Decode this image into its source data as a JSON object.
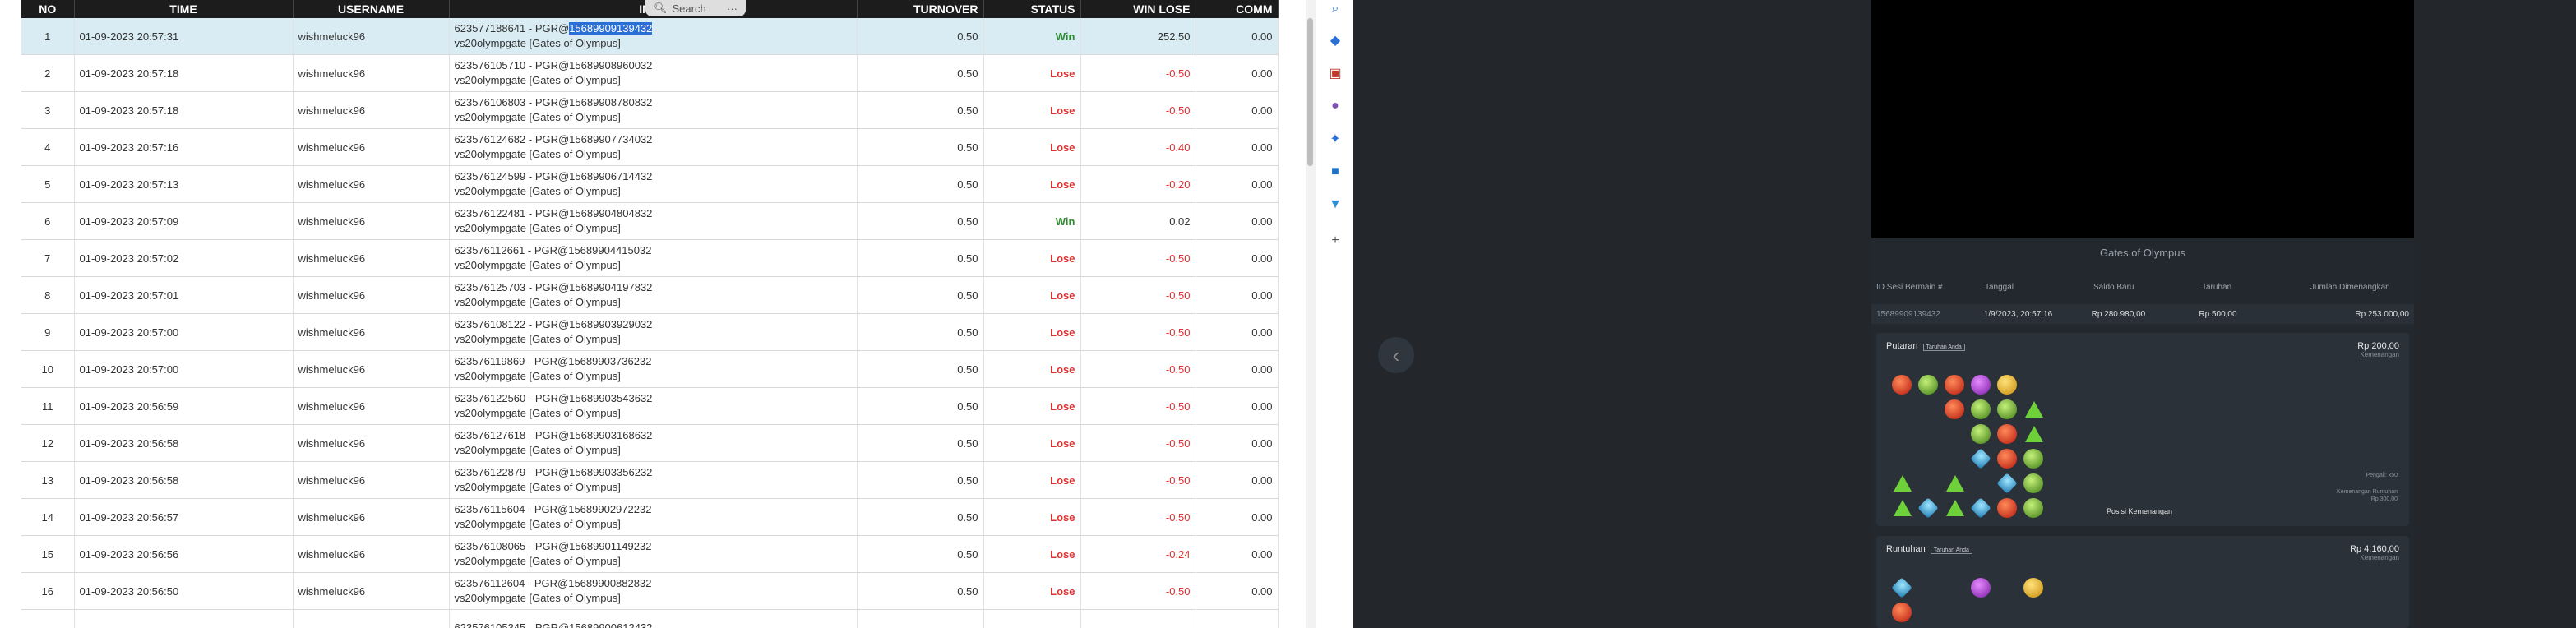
{
  "search": {
    "label": "Search",
    "menu": "···"
  },
  "table": {
    "headers": [
      "NO",
      "TIME",
      "USERNAME",
      "INFO",
      "TURNOVER",
      "STATUS",
      "WIN LOSE",
      "COMM"
    ],
    "rows": [
      {
        "no": "1",
        "time": "01-09-2023 20:57:31",
        "user": "wishmeluck96",
        "info_a": "623577188641 - PGR@",
        "info_hl": "15689909139432",
        "info_b": "vs20olympgate [Gates of Olympus]",
        "turnover": "0.50",
        "status": "Win",
        "winlose": "252.50",
        "comm": "0.00"
      },
      {
        "no": "2",
        "time": "01-09-2023 20:57:18",
        "user": "wishmeluck96",
        "info_a": "623576105710 - PGR@15689908960032",
        "info_hl": "",
        "info_b": "vs20olympgate [Gates of Olympus]",
        "turnover": "0.50",
        "status": "Lose",
        "winlose": "-0.50",
        "comm": "0.00"
      },
      {
        "no": "3",
        "time": "01-09-2023 20:57:18",
        "user": "wishmeluck96",
        "info_a": "623576106803 - PGR@15689908780832",
        "info_hl": "",
        "info_b": "vs20olympgate [Gates of Olympus]",
        "turnover": "0.50",
        "status": "Lose",
        "winlose": "-0.50",
        "comm": "0.00"
      },
      {
        "no": "4",
        "time": "01-09-2023 20:57:16",
        "user": "wishmeluck96",
        "info_a": "623576124682 - PGR@15689907734032",
        "info_hl": "",
        "info_b": "vs20olympgate [Gates of Olympus]",
        "turnover": "0.50",
        "status": "Lose",
        "winlose": "-0.40",
        "comm": "0.00"
      },
      {
        "no": "5",
        "time": "01-09-2023 20:57:13",
        "user": "wishmeluck96",
        "info_a": "623576124599 - PGR@15689906714432",
        "info_hl": "",
        "info_b": "vs20olympgate [Gates of Olympus]",
        "turnover": "0.50",
        "status": "Lose",
        "winlose": "-0.20",
        "comm": "0.00"
      },
      {
        "no": "6",
        "time": "01-09-2023 20:57:09",
        "user": "wishmeluck96",
        "info_a": "623576122481 - PGR@15689904804832",
        "info_hl": "",
        "info_b": "vs20olympgate [Gates of Olympus]",
        "turnover": "0.50",
        "status": "Win",
        "winlose": "0.02",
        "comm": "0.00"
      },
      {
        "no": "7",
        "time": "01-09-2023 20:57:02",
        "user": "wishmeluck96",
        "info_a": "623576112661 - PGR@15689904415032",
        "info_hl": "",
        "info_b": "vs20olympgate [Gates of Olympus]",
        "turnover": "0.50",
        "status": "Lose",
        "winlose": "-0.50",
        "comm": "0.00"
      },
      {
        "no": "8",
        "time": "01-09-2023 20:57:01",
        "user": "wishmeluck96",
        "info_a": "623576125703 - PGR@15689904197832",
        "info_hl": "",
        "info_b": "vs20olympgate [Gates of Olympus]",
        "turnover": "0.50",
        "status": "Lose",
        "winlose": "-0.50",
        "comm": "0.00"
      },
      {
        "no": "9",
        "time": "01-09-2023 20:57:00",
        "user": "wishmeluck96",
        "info_a": "623576108122 - PGR@15689903929032",
        "info_hl": "",
        "info_b": "vs20olympgate [Gates of Olympus]",
        "turnover": "0.50",
        "status": "Lose",
        "winlose": "-0.50",
        "comm": "0.00"
      },
      {
        "no": "10",
        "time": "01-09-2023 20:57:00",
        "user": "wishmeluck96",
        "info_a": "623576119869 - PGR@15689903736232",
        "info_hl": "",
        "info_b": "vs20olympgate [Gates of Olympus]",
        "turnover": "0.50",
        "status": "Lose",
        "winlose": "-0.50",
        "comm": "0.00"
      },
      {
        "no": "11",
        "time": "01-09-2023 20:56:59",
        "user": "wishmeluck96",
        "info_a": "623576122560 - PGR@15689903543632",
        "info_hl": "",
        "info_b": "vs20olympgate [Gates of Olympus]",
        "turnover": "0.50",
        "status": "Lose",
        "winlose": "-0.50",
        "comm": "0.00"
      },
      {
        "no": "12",
        "time": "01-09-2023 20:56:58",
        "user": "wishmeluck96",
        "info_a": "623576127618 - PGR@15689903168632",
        "info_hl": "",
        "info_b": "vs20olympgate [Gates of Olympus]",
        "turnover": "0.50",
        "status": "Lose",
        "winlose": "-0.50",
        "comm": "0.00"
      },
      {
        "no": "13",
        "time": "01-09-2023 20:56:58",
        "user": "wishmeluck96",
        "info_a": "623576122879 - PGR@15689903356232",
        "info_hl": "",
        "info_b": "vs20olympgate [Gates of Olympus]",
        "turnover": "0.50",
        "status": "Lose",
        "winlose": "-0.50",
        "comm": "0.00"
      },
      {
        "no": "14",
        "time": "01-09-2023 20:56:57",
        "user": "wishmeluck96",
        "info_a": "623576115604 - PGR@15689902972232",
        "info_hl": "",
        "info_b": "vs20olympgate [Gates of Olympus]",
        "turnover": "0.50",
        "status": "Lose",
        "winlose": "-0.50",
        "comm": "0.00"
      },
      {
        "no": "15",
        "time": "01-09-2023 20:56:56",
        "user": "wishmeluck96",
        "info_a": "623576108065 - PGR@15689901149232",
        "info_hl": "",
        "info_b": "vs20olympgate [Gates of Olympus]",
        "turnover": "0.50",
        "status": "Lose",
        "winlose": "-0.24",
        "comm": "0.00"
      },
      {
        "no": "16",
        "time": "01-09-2023 20:56:50",
        "user": "wishmeluck96",
        "info_a": "623576112604 - PGR@15689900882832",
        "info_hl": "",
        "info_b": "vs20olympgate [Gates of Olympus]",
        "turnover": "0.50",
        "status": "Lose",
        "winlose": "-0.50",
        "comm": "0.00"
      },
      {
        "no": "",
        "time": "",
        "user": "",
        "info_a": "623576105345 - PGR@15689900612432",
        "info_hl": "",
        "info_b": "",
        "turnover": "",
        "status": "",
        "winlose": "",
        "comm": ""
      }
    ]
  },
  "edge_icons": [
    "search-icon",
    "tag-icon",
    "briefcase-icon",
    "people-icon",
    "copilot-icon",
    "outlook-icon",
    "shopping-icon",
    "plus-icon"
  ],
  "game": {
    "title": "Gates of Olympus",
    "headers": [
      "ID Sesi Bermain #",
      "Tanggal",
      "Saldo Baru",
      "Taruhan",
      "Jumlah Dimenangkan"
    ],
    "row": [
      "15689909139432",
      "1/9/2023, 20:57:16",
      "Rp 280.980,00",
      "Rp 500,00",
      "Rp 253.000,00"
    ],
    "spin": {
      "label": "Putaran",
      "tag": "Taruhan Anda",
      "amount": "Rp 200,00",
      "amount_sub": "Kemenangan",
      "note1": "Pengali: x50",
      "note2": "Kemenangan Runtuhan",
      "note3": "Rp 300,00",
      "link": "Posisi Kemenangan"
    },
    "tumble": {
      "label": "Runtuhan",
      "tag": "Taruhan Anda",
      "amount": "Rp 4.160,00",
      "amount_sub": "Kemenangan"
    },
    "grid1": [
      "r",
      "g",
      "r",
      "p",
      "y",
      "e",
      "e",
      "e",
      "r",
      "g",
      "g",
      "t",
      "e",
      "e",
      "e",
      "g",
      "r",
      "t",
      "e",
      "e",
      "e",
      "b",
      "r",
      "g",
      "t",
      "e",
      "t",
      "e",
      "b",
      "g",
      "t",
      "b",
      "t",
      "b",
      "r",
      "g"
    ],
    "grid2": [
      "b",
      "e",
      "e",
      "p",
      "e",
      "y",
      "r",
      "e",
      "e",
      "e",
      "e",
      "e"
    ]
  },
  "colors": {
    "win": "#2e8b2e",
    "lose": "#e03030",
    "header_bg": "#1c1c1c",
    "selected_row": "#d9ecf3",
    "highlight": "#2a6fd6"
  }
}
